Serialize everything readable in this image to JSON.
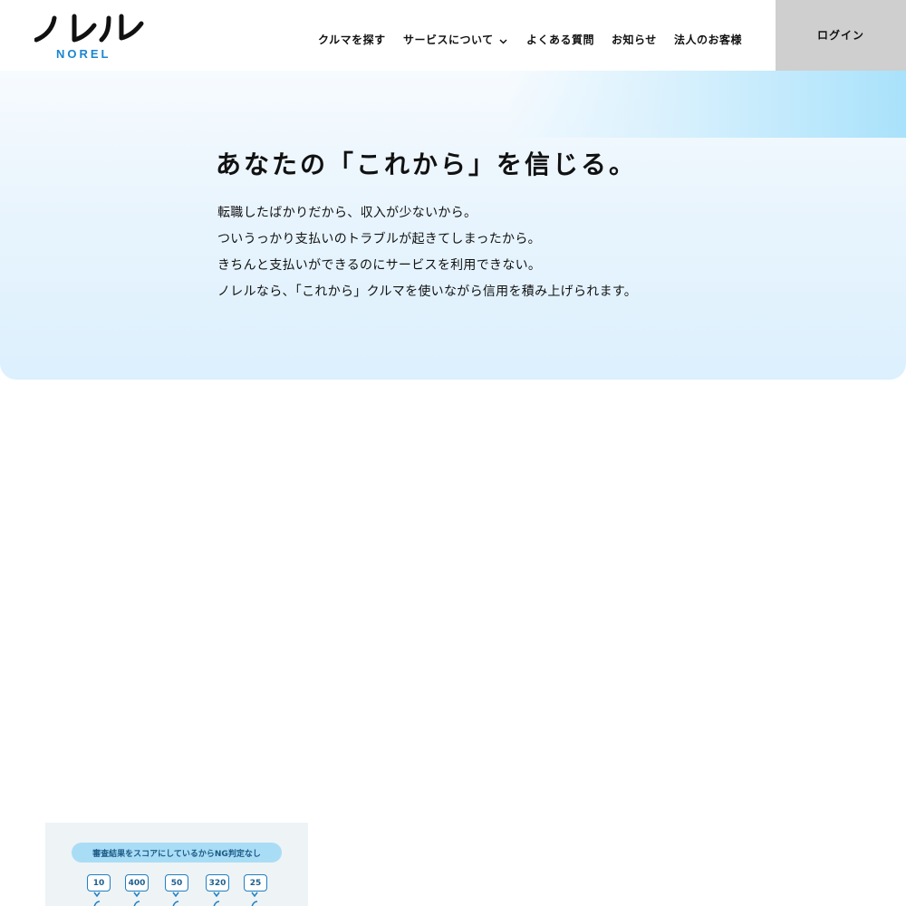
{
  "brand": {
    "logo_text": "ノレル",
    "logo_sub": "NOREL",
    "accent_color": "#1a86d0"
  },
  "nav": {
    "items": [
      {
        "label": "クルマを探す"
      },
      {
        "label": "サービスについて",
        "has_dropdown": true
      },
      {
        "label": "よくある質問"
      },
      {
        "label": "お知らせ"
      },
      {
        "label": "法人のお客様"
      }
    ],
    "login_label": "ログイン"
  },
  "hero": {
    "title": "あなたの「これから」を信じる。",
    "lines": [
      "転職したばかりだから、収入が少ないから。",
      "ついうっかり支払いのトラブルが起きてしまったから。",
      "きちんと支払いができるのにサービスを利用できない。",
      "ノレルなら、「これから」クルマを使いながら信用を積み上げられます。"
    ]
  },
  "card": {
    "pill_text": "審査結果をスコアにしているからNG判定なし",
    "scores": [
      "10",
      "400",
      "50",
      "320",
      "25"
    ]
  }
}
